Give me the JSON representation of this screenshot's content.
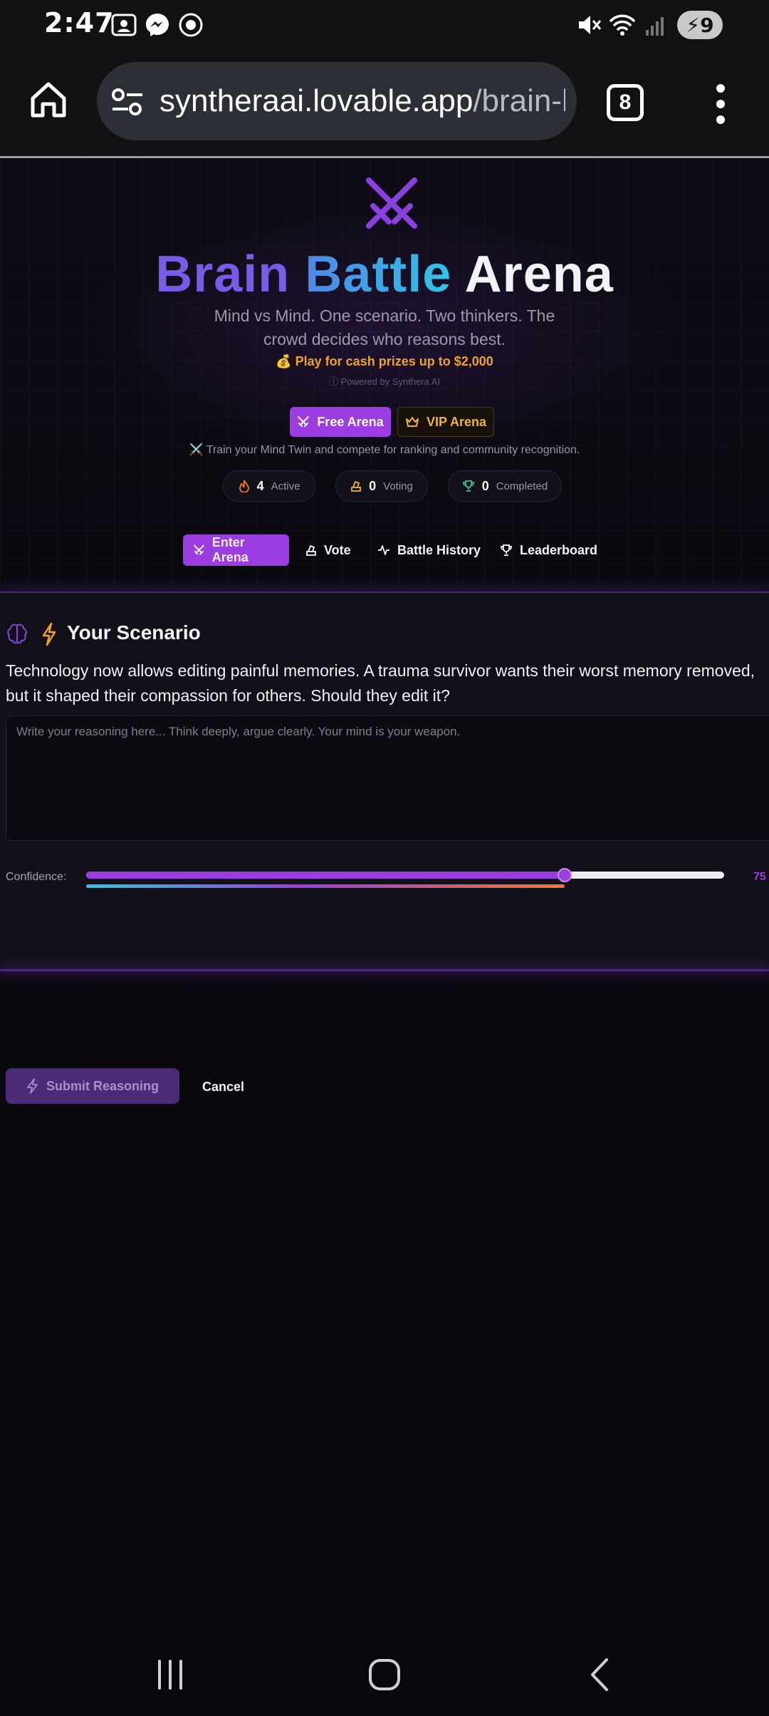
{
  "status_bar": {
    "time": "2:47",
    "battery": "9",
    "icons": [
      "screenshot-icon",
      "messenger-icon",
      "record-icon",
      "mute-icon",
      "wifi-icon",
      "signal-icon",
      "battery-icon"
    ]
  },
  "browser": {
    "url_domain": "syntheraai.lovable.app",
    "url_path": "/brain-battle",
    "tab_count": "8"
  },
  "hero": {
    "title_part1": "Brain",
    "title_part2": "Battle",
    "title_part3": "Arena",
    "subtitle": "Mind vs Mind. One scenario. Two thinkers. The crowd decides who reasons best.",
    "prize": "💰 Play for cash prizes up to $2,000",
    "powered_by": "ⓘ Powered by Synthera AI",
    "free_arena": "Free Arena",
    "vip_arena": "VIP Arena",
    "train_note": "⚔️ Train your Mind Twin and compete for ranking and community recognition."
  },
  "stats": {
    "active_count": "4",
    "active_label": "Active",
    "voting_count": "0",
    "voting_label": "Voting",
    "completed_count": "0",
    "completed_label": "Completed"
  },
  "nav_tabs": {
    "enter": "Enter Arena",
    "vote": "Vote",
    "history": "Battle History",
    "leaderboard": "Leaderboard"
  },
  "scenario": {
    "title": "Your Scenario",
    "text": "Technology now allows editing painful memories. A trauma survivor wants their worst memory removed, but it shaped their compassion for others. Should they edit it?",
    "placeholder": "Write your reasoning here... Think deeply, argue clearly. Your mind is your weapon.",
    "confidence_label": "Confidence:",
    "confidence_value": 75,
    "confidence_display": "75",
    "confidence_bar_fraction": 0.75,
    "submit_label": "Submit Reasoning",
    "cancel_label": "Cancel"
  },
  "colors": {
    "accent": "#9b3de0",
    "gold": "#f0a31c",
    "background": "#08070c"
  }
}
